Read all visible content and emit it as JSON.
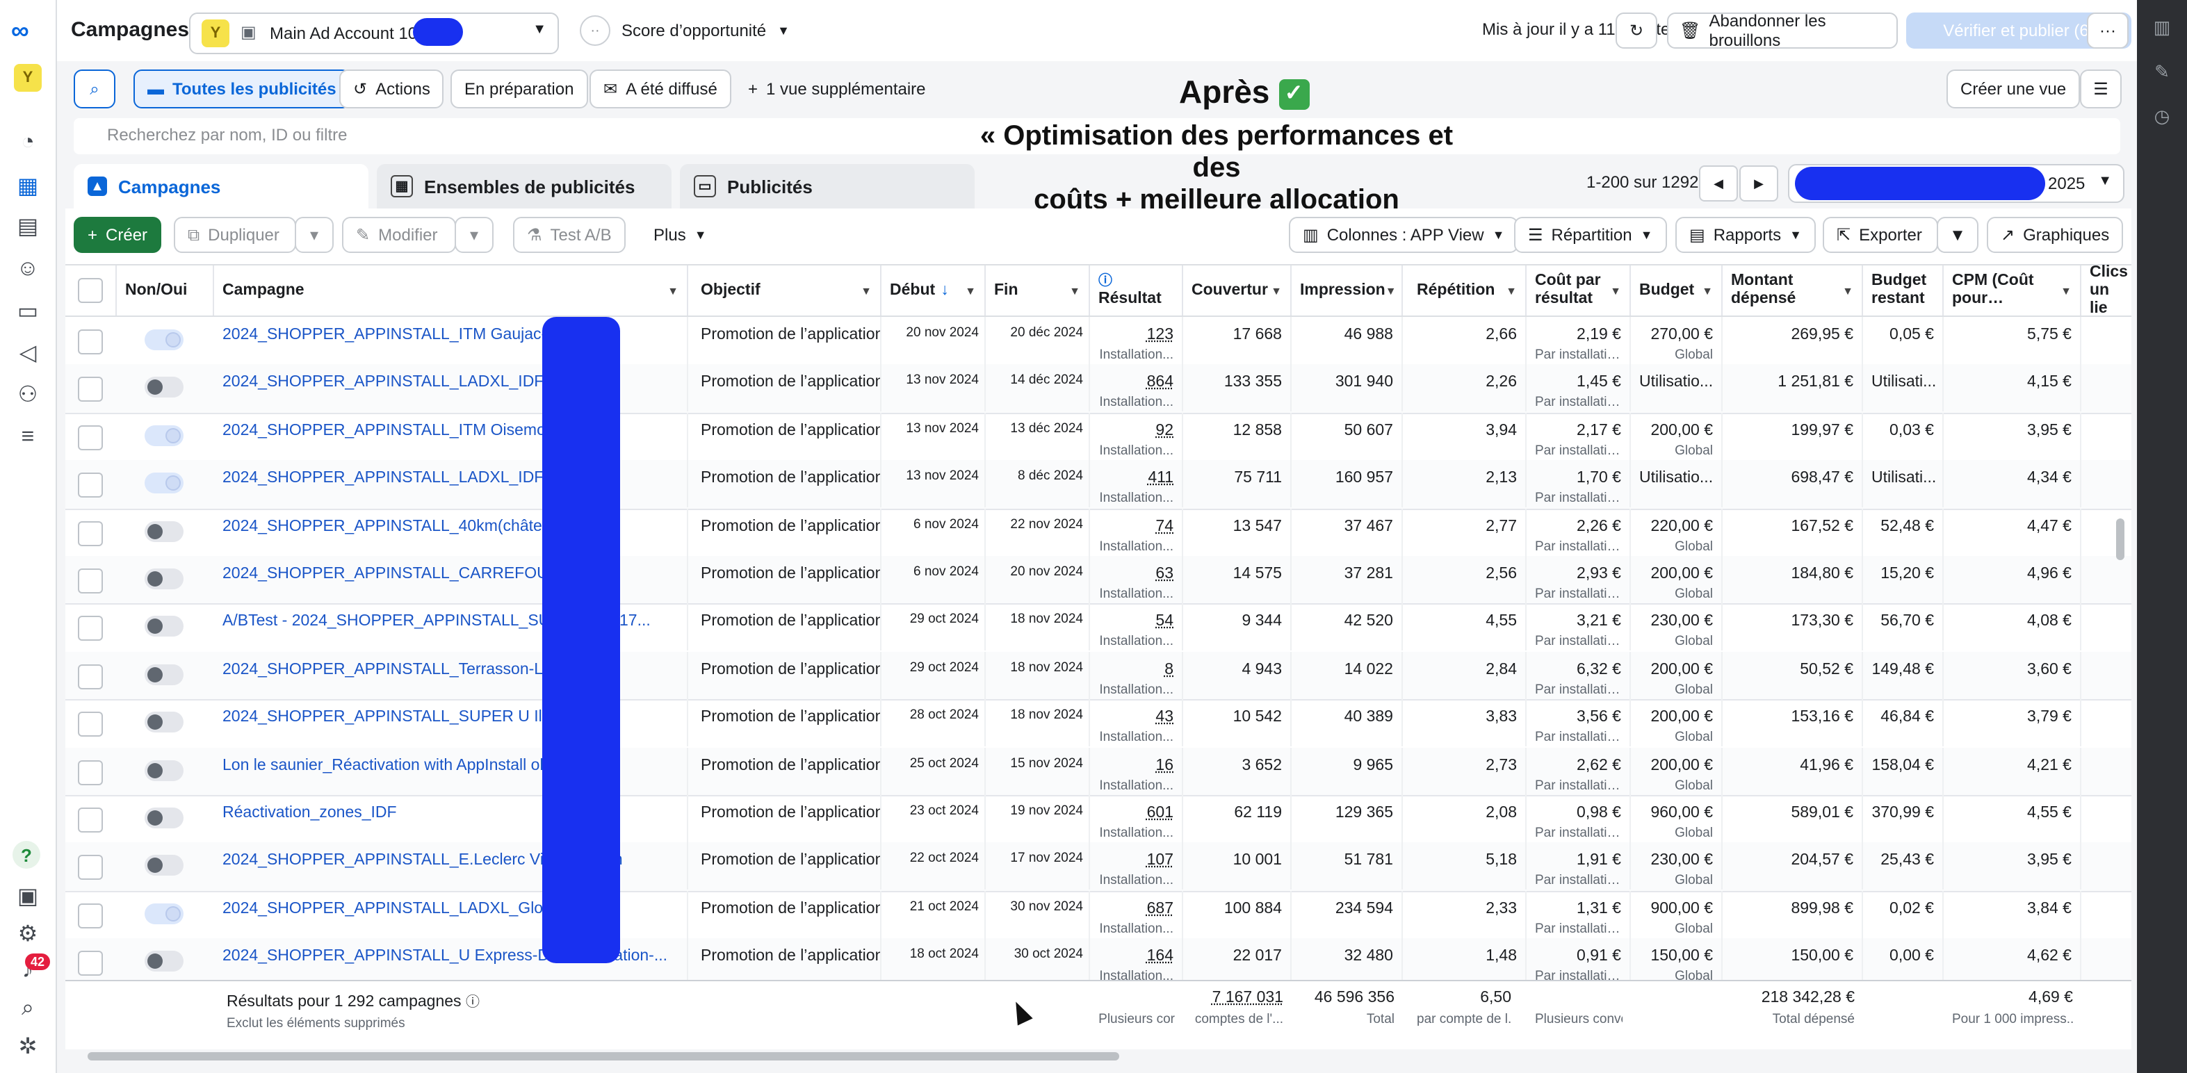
{
  "app": {
    "title": "Campagnes"
  },
  "account": {
    "badge": "Y",
    "name": "Main Ad Account 101"
  },
  "score": {
    "label": "Score d’opportunité"
  },
  "header": {
    "updated": "Mis à jour il y a 11 minutes",
    "discard": "Abandonner les brouillons",
    "publish": "Vérifier et publier (6)",
    "more": "···"
  },
  "views": {
    "all_ads": "Toutes les publicités",
    "actions": "Actions",
    "in_prep": "En préparation",
    "delivered": "A été diffusé",
    "more_views": "1 vue supplémentaire",
    "create_view": "Créer une vue"
  },
  "annotations": {
    "after": "Après",
    "after_check": "✓",
    "headline_1": "« Optimisation des performances et des",
    "headline_2": "coûts + meilleure allocation budgétaire »"
  },
  "search": {
    "placeholder": "Recherchez par nom, ID ou filtre"
  },
  "tabs": {
    "campaigns": "Campagnes",
    "adsets": "Ensembles de publicités",
    "ads": "Publicités"
  },
  "pagination": {
    "range": "1-200 sur 1292"
  },
  "date_range": {
    "year": "2025"
  },
  "toolbar": {
    "create": "Créer",
    "duplicate": "Dupliquer",
    "edit": "Modifier",
    "ab_test": "Test A/B",
    "more": "Plus",
    "columns": "Colonnes : APP View",
    "breakdown": "Répartition",
    "reports": "Rapports",
    "export": "Exporter",
    "charts": "Graphiques"
  },
  "columns": {
    "toggle": "Non/Oui",
    "campaign": "Campagne",
    "objective": "Objectif",
    "start": "Début",
    "end": "Fin",
    "result": "Résultat",
    "reach": "Couvertur",
    "impressions": "Impression",
    "frequency": "Répétition",
    "cpr": "Coût par résultat",
    "budget": "Budget",
    "spent": "Montant dépensé",
    "budget_left": "Budget restant",
    "cpm": "CPM (Coût pour…",
    "clicks": "Clics un lie"
  },
  "rows": [
    {
      "on": true,
      "name": "2024_SHOPPER_APPINSTALL_ITM Gaujac-20km",
      "objective": "Promotion de l’application",
      "start": "20 nov 2024",
      "end": "20 déc 2024",
      "result": "123",
      "result_sub": "Installation...",
      "reach": "17 668",
      "impressions": "46 988",
      "frequency": "2,66",
      "cpr": "2,19 €",
      "cpr_sub": "Par installatio...",
      "budget": "270,00 €",
      "budget_sub": "Global",
      "spent": "269,95 €",
      "left": "0,05 €",
      "cpm": "5,75 €"
    },
    {
      "on": false,
      "name": "2024_SHOPPER_APPINSTALL_LADXL_IDF_EMO",
      "objective": "Promotion de l’application",
      "start": "13 nov 2024",
      "end": "14 déc 2024",
      "result": "864",
      "result_sub": "Installation...",
      "reach": "133 355",
      "impressions": "301 940",
      "frequency": "2,26",
      "cpr": "1,45 €",
      "cpr_sub": "Par installatio...",
      "budget": "Utilisatio...",
      "budget_sub": "",
      "spent": "1 251,81 €",
      "left": "Utilisati...",
      "cpm": "4,15 €"
    },
    {
      "on": true,
      "name": "2024_SHOPPER_APPINSTALL_ITM Oisemont-1",
      "objective": "Promotion de l’application",
      "start": "13 nov 2024",
      "end": "13 déc 2024",
      "result": "92",
      "result_sub": "Installation...",
      "reach": "12 858",
      "impressions": "50 607",
      "frequency": "3,94",
      "cpr": "2,17 €",
      "cpr_sub": "Par installatio...",
      "budget": "200,00 €",
      "budget_sub": "Global",
      "spent": "199,97 €",
      "left": "0,03 €",
      "cpm": "3,95 €"
    },
    {
      "on": true,
      "name": "2024_SHOPPER_APPINSTALL_LADXL_IDF only",
      "objective": "Promotion de l’application",
      "start": "13 nov 2024",
      "end": "8 déc 2024",
      "result": "411",
      "result_sub": "Installation...",
      "reach": "75 711",
      "impressions": "160 957",
      "frequency": "2,13",
      "cpr": "1,70 €",
      "cpr_sub": "Par installatio...",
      "budget": "Utilisatio...",
      "budget_sub": "",
      "spent": "698,47 €",
      "left": "Utilisati...",
      "cpm": "4,34 €"
    },
    {
      "on": false,
      "name": "2024_SHOPPER_APPINSTALL_40km(château-sur-A...",
      "objective": "Promotion de l’application",
      "start": "6 nov 2024",
      "end": "22 nov 2024",
      "result": "74",
      "result_sub": "Installation...",
      "reach": "13 547",
      "impressions": "37 467",
      "frequency": "2,77",
      "cpr": "2,26 €",
      "cpr_sub": "Par installatio...",
      "budget": "220,00 €",
      "budget_sub": "Global",
      "spent": "167,52 €",
      "left": "52,48 €",
      "cpm": "4,47 €"
    },
    {
      "on": false,
      "name": "2024_SHOPPER_APPINSTALL_CARREFOUR Tre",
      "objective": "Promotion de l’application",
      "start": "6 nov 2024",
      "end": "20 nov 2024",
      "result": "63",
      "result_sub": "Installation...",
      "reach": "14 575",
      "impressions": "37 281",
      "frequency": "2,56",
      "cpr": "2,93 €",
      "cpr_sub": "Par installatio...",
      "budget": "200,00 €",
      "budget_sub": "Global",
      "spent": "184,80 €",
      "left": "15,20 €",
      "cpm": "4,96 €"
    },
    {
      "on": false,
      "name": "A/BTest - 2024_SHOPPER_APPINSTALL_SU Be...nde-17...",
      "objective": "Promotion de l’application",
      "start": "29 oct 2024",
      "end": "18 nov 2024",
      "result": "54",
      "result_sub": "Installation...",
      "reach": "9 344",
      "impressions": "42 520",
      "frequency": "4,55",
      "cpr": "3,21 €",
      "cpr_sub": "Par installatio...",
      "budget": "230,00 €",
      "budget_sub": "Global",
      "spent": "173,30 €",
      "left": "56,70 €",
      "cpm": "4,08 €"
    },
    {
      "on": false,
      "name": "2024_SHOPPER_APPINSTALL_Terrasson-Laville",
      "objective": "Promotion de l’application",
      "start": "29 oct 2024",
      "end": "18 nov 2024",
      "result": "8",
      "result_sub": "Installation...",
      "reach": "4 943",
      "impressions": "14 022",
      "frequency": "2,84",
      "cpr": "6,32 €",
      "cpr_sub": "Par installatio...",
      "budget": "200,00 €",
      "budget_sub": "Global",
      "spent": "50,52 €",
      "left": "149,48 €",
      "cpm": "3,60 €"
    },
    {
      "on": false,
      "name": "2024_SHOPPER_APPINSTALL_SUPER U Ille-su",
      "objective": "Promotion de l’application",
      "start": "28 oct 2024",
      "end": "18 nov 2024",
      "result": "43",
      "result_sub": "Installation...",
      "reach": "10 542",
      "impressions": "40 389",
      "frequency": "3,83",
      "cpr": "3,56 €",
      "cpr_sub": "Par installatio...",
      "budget": "200,00 €",
      "budget_sub": "Global",
      "spent": "153,16 €",
      "left": "46,84 €",
      "cpm": "3,79 €"
    },
    {
      "on": false,
      "name": "Lon le saunier_Réactivation with AppInstall obje",
      "objective": "Promotion de l’application",
      "start": "25 oct 2024",
      "end": "15 nov 2024",
      "result": "16",
      "result_sub": "Installation...",
      "reach": "3 652",
      "impressions": "9 965",
      "frequency": "2,73",
      "cpr": "2,62 €",
      "cpr_sub": "Par installatio...",
      "budget": "200,00 €",
      "budget_sub": "Global",
      "spent": "41,96 €",
      "left": "158,04 €",
      "cpm": "4,21 €"
    },
    {
      "on": false,
      "name": "Réactivation_zones_IDF",
      "objective": "Promotion de l’application",
      "start": "23 oct 2024",
      "end": "19 nov 2024",
      "result": "601",
      "result_sub": "Installation...",
      "reach": "62 119",
      "impressions": "129 365",
      "frequency": "2,08",
      "cpr": "0,98 €",
      "cpr_sub": "Par installatio...",
      "budget": "960,00 €",
      "budget_sub": "Global",
      "spent": "589,01 €",
      "left": "370,99 €",
      "cpm": "4,55 €"
    },
    {
      "on": false,
      "name": "2024_SHOPPER_APPINSTALL_E.Leclerc Vitry-l...17km",
      "objective": "Promotion de l’application",
      "start": "22 oct 2024",
      "end": "17 nov 2024",
      "result": "107",
      "result_sub": "Installation...",
      "reach": "10 001",
      "impressions": "51 781",
      "frequency": "5,18",
      "cpr": "1,91 €",
      "cpr_sub": "Par installatio...",
      "budget": "230,00 €",
      "budget_sub": "Global",
      "spent": "204,57 €",
      "left": "25,43 €",
      "cpm": "3,95 €"
    },
    {
      "on": true,
      "name": "2024_SHOPPER_APPINSTALL_LADXL_Global_",
      "objective": "Promotion de l’application",
      "start": "21 oct 2024",
      "end": "30 nov 2024",
      "result": "687",
      "result_sub": "Installation...",
      "reach": "100 884",
      "impressions": "234 594",
      "frequency": "2,33",
      "cpr": "1,31 €",
      "cpr_sub": "Par installatio...",
      "budget": "900,00 €",
      "budget_sub": "Global",
      "spent": "899,98 €",
      "left": "0,02 €",
      "cpm": "3,84 €"
    },
    {
      "on": false,
      "name": "2024_SHOPPER_APPINSTALL_U Express-Dufre...ctivation-...",
      "objective": "Promotion de l’application",
      "start": "18 oct 2024",
      "end": "30 oct 2024",
      "result": "164",
      "result_sub": "Installation...",
      "reach": "22 017",
      "impressions": "32 480",
      "frequency": "1,48",
      "cpr": "0,91 €",
      "cpr_sub": "Par installatio...",
      "budget": "150,00 €",
      "budget_sub": "Global",
      "spent": "150,00 €",
      "left": "0,00 €",
      "cpm": "4,62 €"
    }
  ],
  "summary": {
    "title": "Résultats pour 1 292 campagnes",
    "subtitle": "Exclut les éléments supprimés",
    "result_sub": "Plusieurs cor",
    "reach": "7 167 031",
    "reach_sub": "comptes de l'...",
    "impressions": "46 596 356",
    "impressions_sub": "Total",
    "frequency": "6,50",
    "frequency_sub": "par compte de l...",
    "cpr_sub": "Plusieurs conve",
    "spent": "218 342,28 €",
    "spent_sub": "Total dépensé",
    "cpm": "4,69 €",
    "cpm_sub": "Pour 1 000 impress..."
  },
  "rail": {
    "notifications": "42"
  }
}
